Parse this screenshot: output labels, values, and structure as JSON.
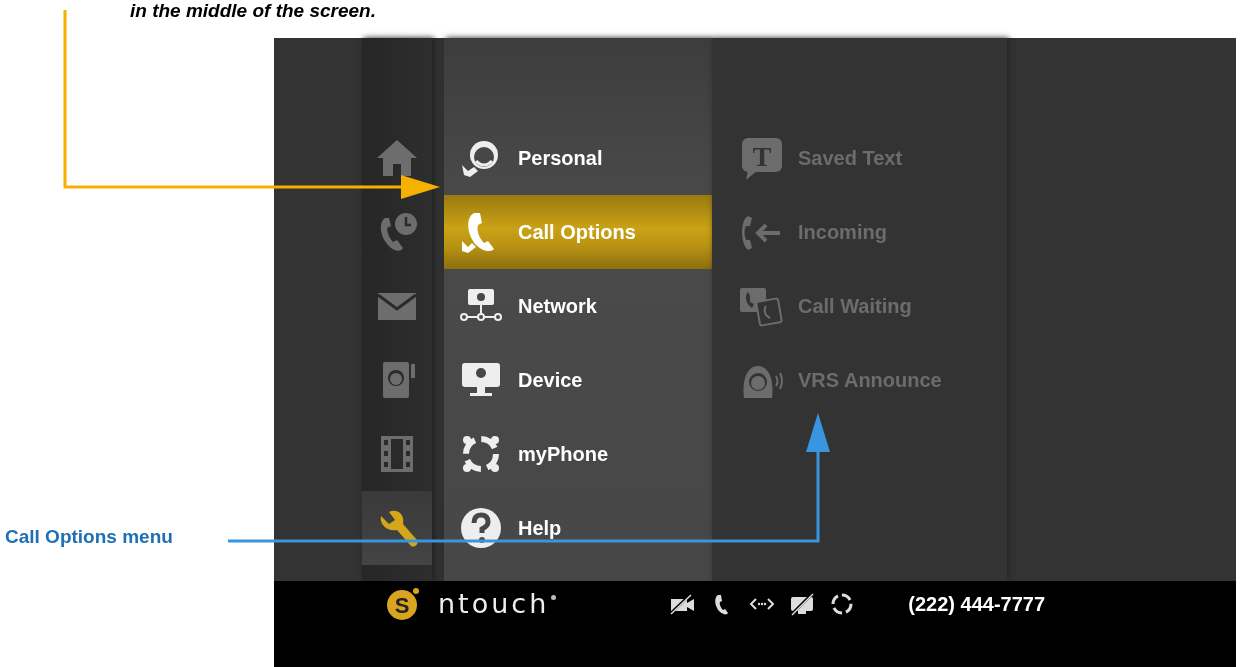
{
  "caption_text": "in the middle of the screen.",
  "callout": {
    "label": "Call Options menu"
  },
  "side_nav": [
    {
      "kind": "home",
      "selected": false
    },
    {
      "kind": "call-history",
      "selected": false
    },
    {
      "kind": "mail",
      "selected": false
    },
    {
      "kind": "contacts",
      "selected": false
    },
    {
      "kind": "video",
      "selected": false
    },
    {
      "kind": "settings",
      "selected": true
    }
  ],
  "settings_menu": [
    {
      "label": "Personal",
      "kind": "personal",
      "selected": false
    },
    {
      "label": "Call Options",
      "kind": "call-options",
      "selected": true
    },
    {
      "label": "Network",
      "kind": "network",
      "selected": false
    },
    {
      "label": "Device",
      "kind": "device",
      "selected": false
    },
    {
      "label": "myPhone",
      "kind": "myphone",
      "selected": false
    },
    {
      "label": "Help",
      "kind": "help",
      "selected": false
    }
  ],
  "submenu": [
    {
      "label": "Saved Text",
      "kind": "saved-text",
      "icon_letter": "T"
    },
    {
      "label": "Incoming",
      "kind": "incoming"
    },
    {
      "label": "Call Waiting",
      "kind": "call-waiting"
    },
    {
      "label": "VRS Announce",
      "kind": "vrs-announce"
    }
  ],
  "status_bar": {
    "logo_letter": "S",
    "brand": "ntouch",
    "status_icons": [
      {
        "kind": "video-off"
      },
      {
        "kind": "phone"
      },
      {
        "kind": "connection"
      },
      {
        "kind": "screen-off"
      },
      {
        "kind": "ring"
      }
    ],
    "phone_number": "(222) 444-7777"
  }
}
